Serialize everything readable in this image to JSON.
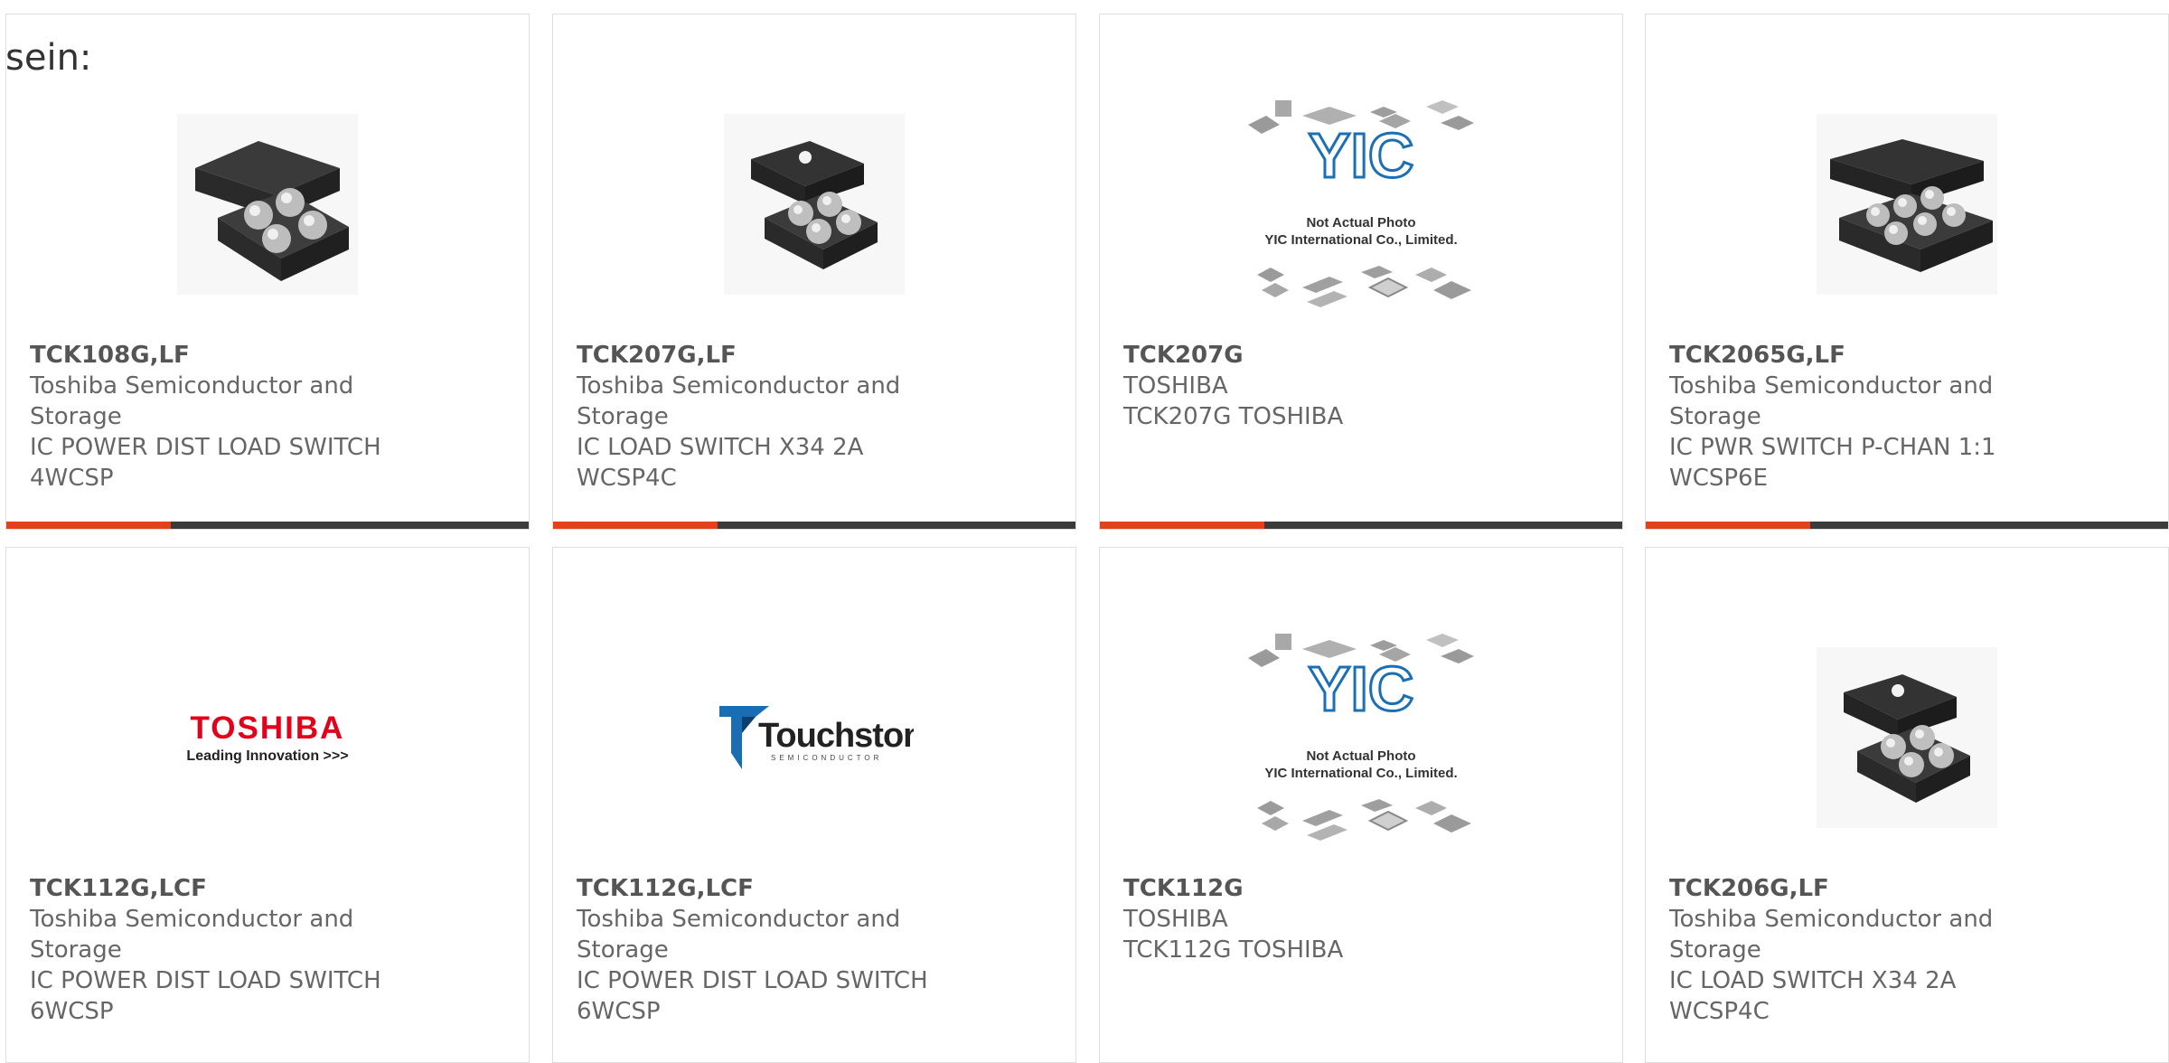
{
  "intro_text": "sein:",
  "colors": {
    "accent": "#e4401d",
    "bar": "#3b3b3b",
    "border": "#dedede"
  },
  "products": [
    {
      "image": "chip-4-ball-icon",
      "part": "TCK108G,LF",
      "lines": [
        "Toshiba Semiconductor and",
        "Storage",
        "IC POWER DIST LOAD SWITCH",
        "4WCSP"
      ]
    },
    {
      "image": "chip-4-ball-dot-icon",
      "part": "TCK207G,LF",
      "lines": [
        "Toshiba Semiconductor and",
        "Storage",
        "IC LOAD SWITCH X34 2A",
        "WCSP4C"
      ]
    },
    {
      "image": "yic-placeholder-icon",
      "image_caption": [
        "Not Actual Photo",
        "YIC International Co., Limited."
      ],
      "part": "TCK207G",
      "lines": [
        "TOSHIBA",
        "TCK207G TOSHIBA"
      ]
    },
    {
      "image": "chip-6-ball-icon",
      "part": "TCK2065G,LF",
      "lines": [
        "Toshiba Semiconductor and",
        "Storage",
        "IC PWR SWITCH P-CHAN 1:1",
        "WCSP6E"
      ]
    },
    {
      "image": "toshiba-logo",
      "logo_text": [
        "TOSHIBA",
        "Leading Innovation >>>"
      ],
      "part": "TCK112G,LCF",
      "lines": [
        "Toshiba Semiconductor and",
        "Storage",
        "IC POWER DIST LOAD SWITCH",
        "6WCSP"
      ]
    },
    {
      "image": "touchstone-logo",
      "logo_text": [
        "Touchstone",
        "SEMICONDUCTOR"
      ],
      "part": "TCK112G,LCF",
      "lines": [
        "Toshiba Semiconductor and",
        "Storage",
        "IC POWER DIST LOAD SWITCH",
        "6WCSP"
      ]
    },
    {
      "image": "yic-placeholder-icon",
      "image_caption": [
        "Not Actual Photo",
        "YIC International Co., Limited."
      ],
      "part": "TCK112G",
      "lines": [
        "TOSHIBA",
        "TCK112G TOSHIBA"
      ]
    },
    {
      "image": "chip-4-ball-dot-icon",
      "part": "TCK206G,LF",
      "lines": [
        "Toshiba Semiconductor and",
        "Storage",
        "IC LOAD SWITCH X34 2A",
        "WCSP4C"
      ]
    }
  ]
}
